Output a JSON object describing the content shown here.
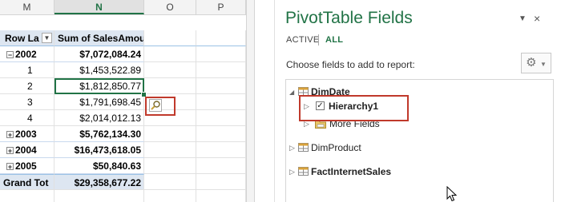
{
  "sheet": {
    "columns": [
      "M",
      "N",
      "O",
      "P"
    ],
    "header": {
      "row_label": "Row La",
      "value_label": "Sum of SalesAmount"
    },
    "rows": [
      {
        "label": "2002",
        "value": "$7,072,084.24",
        "kind": "year",
        "state": "collapse"
      },
      {
        "label": "1",
        "value": "$1,453,522.89",
        "kind": "month"
      },
      {
        "label": "2",
        "value": "$1,812,850.77",
        "kind": "month",
        "selected": true
      },
      {
        "label": "3",
        "value": "$1,791,698.45",
        "kind": "month"
      },
      {
        "label": "4",
        "value": "$2,014,012.13",
        "kind": "month"
      },
      {
        "label": "2003",
        "value": "$5,762,134.30",
        "kind": "year",
        "state": "expand"
      },
      {
        "label": "2004",
        "value": "$16,473,618.05",
        "kind": "year",
        "state": "expand"
      },
      {
        "label": "2005",
        "value": "$50,840.63",
        "kind": "year",
        "state": "expand"
      },
      {
        "label": "Grand Tot",
        "value": "$29,358,677.22",
        "kind": "total"
      }
    ],
    "symbols": {
      "collapse": "−",
      "expand": "+",
      "filter": "▼"
    }
  },
  "pane": {
    "title": "PivotTable Fields",
    "close_glyph": "×",
    "menu_glyph": "▼",
    "tabs": {
      "active": "ACTIVE",
      "all": "ALL"
    },
    "choose_text": "Choose fields to add to report:",
    "gear_glyph": "⚙",
    "fields": {
      "dimdate": "DimDate",
      "hierarchy": "Hierarchy1",
      "more_fields": "More Fields",
      "dimproduct": "DimProduct",
      "fact": "FactInternetSales"
    },
    "hierarchy_checked": "✓"
  },
  "colors": {
    "accent": "#217346",
    "highlight": "#c0392b",
    "header_fill": "#dde6f1"
  }
}
